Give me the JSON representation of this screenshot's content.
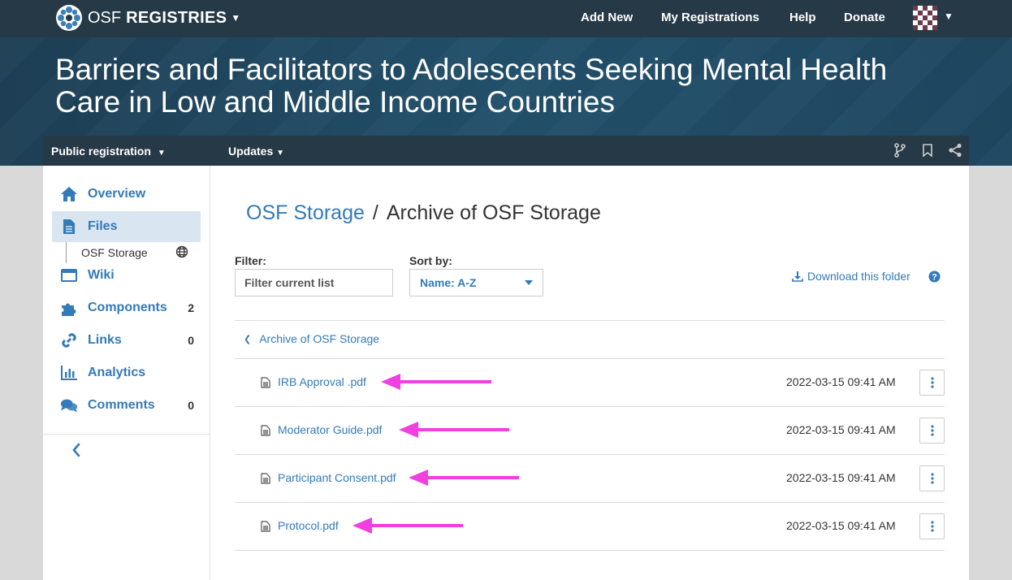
{
  "navbar": {
    "brand_osf": "OSF",
    "brand_registries": "REGISTRIES",
    "links": [
      "Add New",
      "My Registrations",
      "Help",
      "Donate"
    ]
  },
  "header": {
    "title": "Barriers and Facilitators to Adolescents Seeking Mental Health Care in Low and Middle Income Countries"
  },
  "subnav": {
    "public_registration": "Public registration",
    "updates": "Updates"
  },
  "sidebar": {
    "items": [
      {
        "label": "Overview",
        "count": "",
        "icon": "home-icon"
      },
      {
        "label": "Files",
        "count": "",
        "icon": "file-icon"
      },
      {
        "label": "Wiki",
        "count": "",
        "icon": "wiki-icon"
      },
      {
        "label": "Components",
        "count": "2",
        "icon": "puzzle-icon"
      },
      {
        "label": "Links",
        "count": "0",
        "icon": "link-icon"
      },
      {
        "label": "Analytics",
        "count": "",
        "icon": "analytics-icon"
      },
      {
        "label": "Comments",
        "count": "0",
        "icon": "comments-icon"
      }
    ],
    "storage_label": "OSF Storage"
  },
  "content": {
    "breadcrumb_root": "OSF Storage",
    "breadcrumb_sep": "/",
    "breadcrumb_current": "Archive of OSF Storage",
    "filter_label": "Filter:",
    "filter_placeholder": "Filter current list",
    "sort_label": "Sort by:",
    "sort_value": "Name: A-Z",
    "download_label": "Download this folder",
    "parent_folder": "Archive of OSF Storage",
    "files": [
      {
        "name": "IRB Approval .pdf",
        "date": "2022-03-15 09:41 AM"
      },
      {
        "name": "Moderator Guide.pdf",
        "date": "2022-03-15 09:41 AM"
      },
      {
        "name": "Participant Consent.pdf",
        "date": "2022-03-15 09:41 AM"
      },
      {
        "name": "Protocol.pdf",
        "date": "2022-03-15 09:41 AM"
      }
    ]
  },
  "colors": {
    "navbar": "#263947",
    "link": "#337ab7",
    "annotation_arrow": "#f23fe0"
  }
}
